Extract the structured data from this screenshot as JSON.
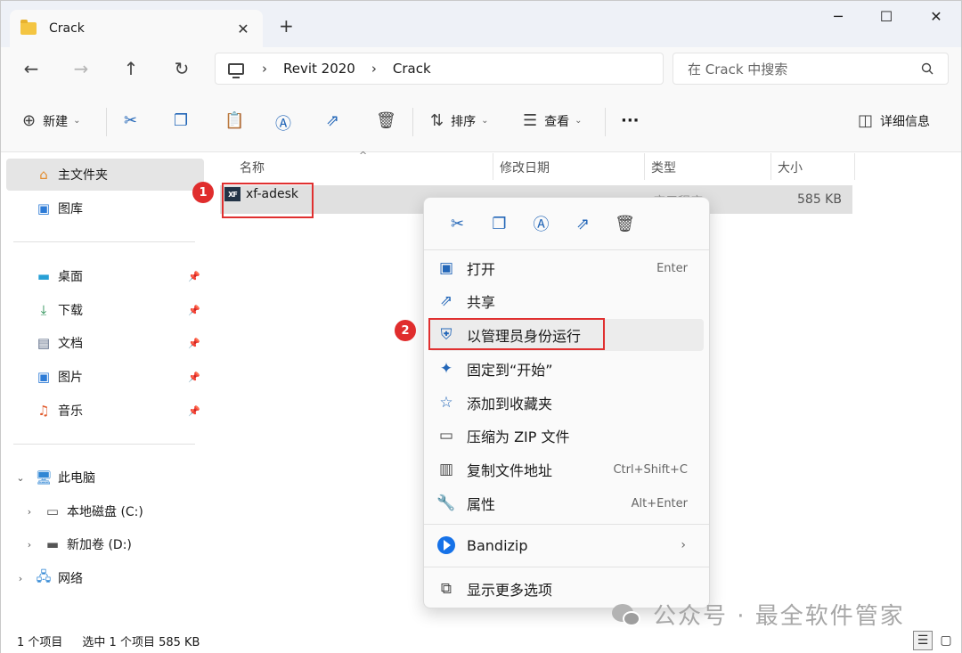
{
  "window": {
    "tab_title": "Crack",
    "tab_close": "✕",
    "new_tab": "+",
    "minimize": "─",
    "maximize": "☐",
    "close": "✕"
  },
  "nav": {
    "back": "←",
    "forward": "→",
    "up": "↑",
    "refresh": "↻",
    "breadcrumb": [
      "Revit 2020",
      "Crack"
    ],
    "separator": "›",
    "search_placeholder": "在 Crack 中搜索"
  },
  "toolbar": {
    "new_label": "新建",
    "sort_label": "排序",
    "view_label": "查看",
    "more": "···",
    "details_label": "详细信息"
  },
  "sidebar": {
    "home": "主文件夹",
    "gallery": "图库",
    "quick": [
      "桌面",
      "下载",
      "文档",
      "图片",
      "音乐"
    ],
    "this_pc": "此电脑",
    "drive_c": "本地磁盘 (C:)",
    "drive_d": "新加卷 (D:)",
    "network": "网络"
  },
  "columns": {
    "name": "名称",
    "modified": "修改日期",
    "type": "类型",
    "size": "大小"
  },
  "file": {
    "icon_text": "XF",
    "name": "xf-adesk",
    "type": "应用程序",
    "size": "585 KB"
  },
  "badges": {
    "one": "1",
    "two": "2"
  },
  "context_menu": {
    "items": [
      {
        "label": "打开",
        "shortcut": "Enter"
      },
      {
        "label": "共享",
        "shortcut": ""
      },
      {
        "label": "以管理员身份运行",
        "shortcut": ""
      },
      {
        "label": "固定到“开始”",
        "shortcut": ""
      },
      {
        "label": "添加到收藏夹",
        "shortcut": ""
      },
      {
        "label": "压缩为 ZIP 文件",
        "shortcut": ""
      },
      {
        "label": "复制文件地址",
        "shortcut": "Ctrl+Shift+C"
      },
      {
        "label": "属性",
        "shortcut": "Alt+Enter"
      }
    ],
    "bandizip": "Bandizip",
    "more_options": "显示更多选项"
  },
  "status": {
    "count": "1 个项目",
    "selected": "选中 1 个项目  585 KB"
  },
  "watermark": "公众号 · 最全软件管家",
  "colors": {
    "accent": "#2467b8",
    "highlight_red": "#e03030"
  }
}
